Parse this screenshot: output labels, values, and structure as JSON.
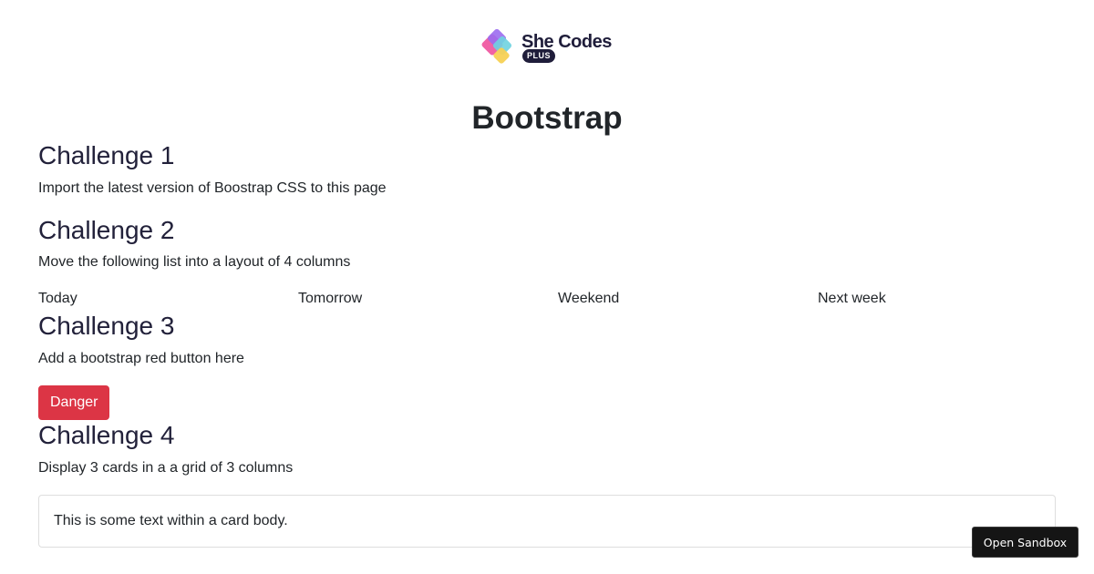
{
  "logo": {
    "wordmark": "She Codes",
    "badge": "PLUS",
    "icon": "she-codes-diamond-logo",
    "colors": [
      "#ef5aa1",
      "#9b6cf0",
      "#6fd3e0",
      "#f7d154"
    ]
  },
  "page": {
    "title": "Bootstrap"
  },
  "challenges": [
    {
      "heading": "Challenge 1",
      "description": "Import the latest version of Boostrap CSS to this page"
    },
    {
      "heading": "Challenge 2",
      "description": "Move the following list into a layout of 4 columns",
      "items": [
        "Today",
        "Tomorrow",
        "Weekend",
        "Next week"
      ]
    },
    {
      "heading": "Challenge 3",
      "description": "Add a bootstrap red button here",
      "button_label": "Danger",
      "button_color": "#dc3545"
    },
    {
      "heading": "Challenge 4",
      "description": "Display 3 cards in a a grid of 3 columns",
      "card_text": "This is some text within a card body."
    }
  ],
  "sandbox": {
    "button_label": "Open Sandbox"
  }
}
